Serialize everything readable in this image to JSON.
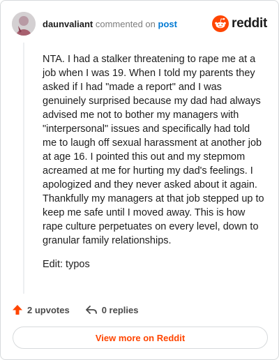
{
  "comment": {
    "username": "daunvaliant",
    "commented_on_text": "commented on",
    "post_link_text": "post",
    "paragraphs": [
      "NTA. I had a stalker threatening to rape me at a job when I was 19. When I told my parents they asked if I had \"made a report\" and I was genuinely surprised because my dad had always advised me not to bother my managers with \"interpersonal\" issues and specifically had told me to laugh off sexual harassment at another job at age 16. I pointed this out and my stepmom acreamed at me for hurting my dad's feelings. I apologized and they never asked about it again. Thankfully my managers at that job stepped up to keep me safe until I moved away. This is how rape culture perpetuates on every level, down to granular family relationships.",
      "Edit: typos"
    ],
    "upvotes_label": "2 upvotes",
    "replies_label": "0 replies"
  },
  "brand": {
    "name": "reddit",
    "icon": "reddit-logo-icon",
    "color": "#ff4500"
  },
  "footer": {
    "view_more_label": "View more on Reddit"
  },
  "colors": {
    "accent": "#ff4500",
    "link": "#0079d3",
    "muted": "#7c7c7c"
  }
}
